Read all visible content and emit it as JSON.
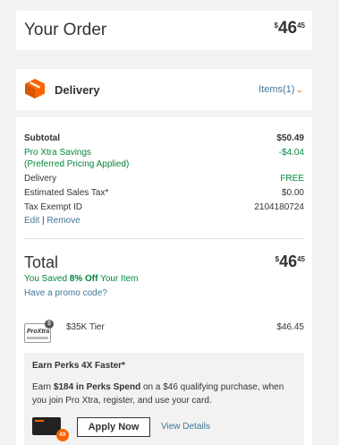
{
  "order": {
    "title": "Your Order",
    "price_dollar": "$",
    "price_main": "46",
    "price_cents": "45"
  },
  "delivery": {
    "icon": "box-icon",
    "label": "Delivery",
    "items_link": "Items(1)",
    "chevron": "chevron-down-icon"
  },
  "summary": {
    "subtotal_label": "Subtotal",
    "subtotal_value": "$50.49",
    "savings_label_1": "Pro Xtra Savings",
    "savings_label_2": "(Preferred Pricing Applied)",
    "savings_value": "-$4.04",
    "delivery_label": "Delivery",
    "delivery_value": "FREE",
    "tax_label": "Estimated Sales Tax*",
    "tax_value": "$0.00",
    "tax_exempt_label": "Tax Exempt ID",
    "tax_exempt_value": "2104180724",
    "edit_label": "Edit",
    "separator": "|",
    "remove_label": "Remove"
  },
  "total": {
    "label": "Total",
    "price_dollar": "$",
    "price_main": "46",
    "price_cents": "45",
    "saved_prefix": "You Saved ",
    "saved_pct": "8% Off",
    "saved_suffix": " Your Item",
    "promo_link": "Have a promo code?"
  },
  "tier": {
    "logo_text": "ProXtra",
    "label": "$35K Tier",
    "value": "$46.45"
  },
  "perks": {
    "title": "Earn Perks 4X Faster*",
    "text_prefix": "Earn ",
    "text_bold": "$184 in Perks Spend",
    "text_suffix": " on a $46 qualifying purchase, when you join Pro Xtra, register, and use your card.",
    "badge": "4X",
    "apply_button": "Apply Now",
    "view_details": "View Details"
  },
  "colors": {
    "accent": "#f96302",
    "link": "#3e7697",
    "green": "#00873c"
  }
}
